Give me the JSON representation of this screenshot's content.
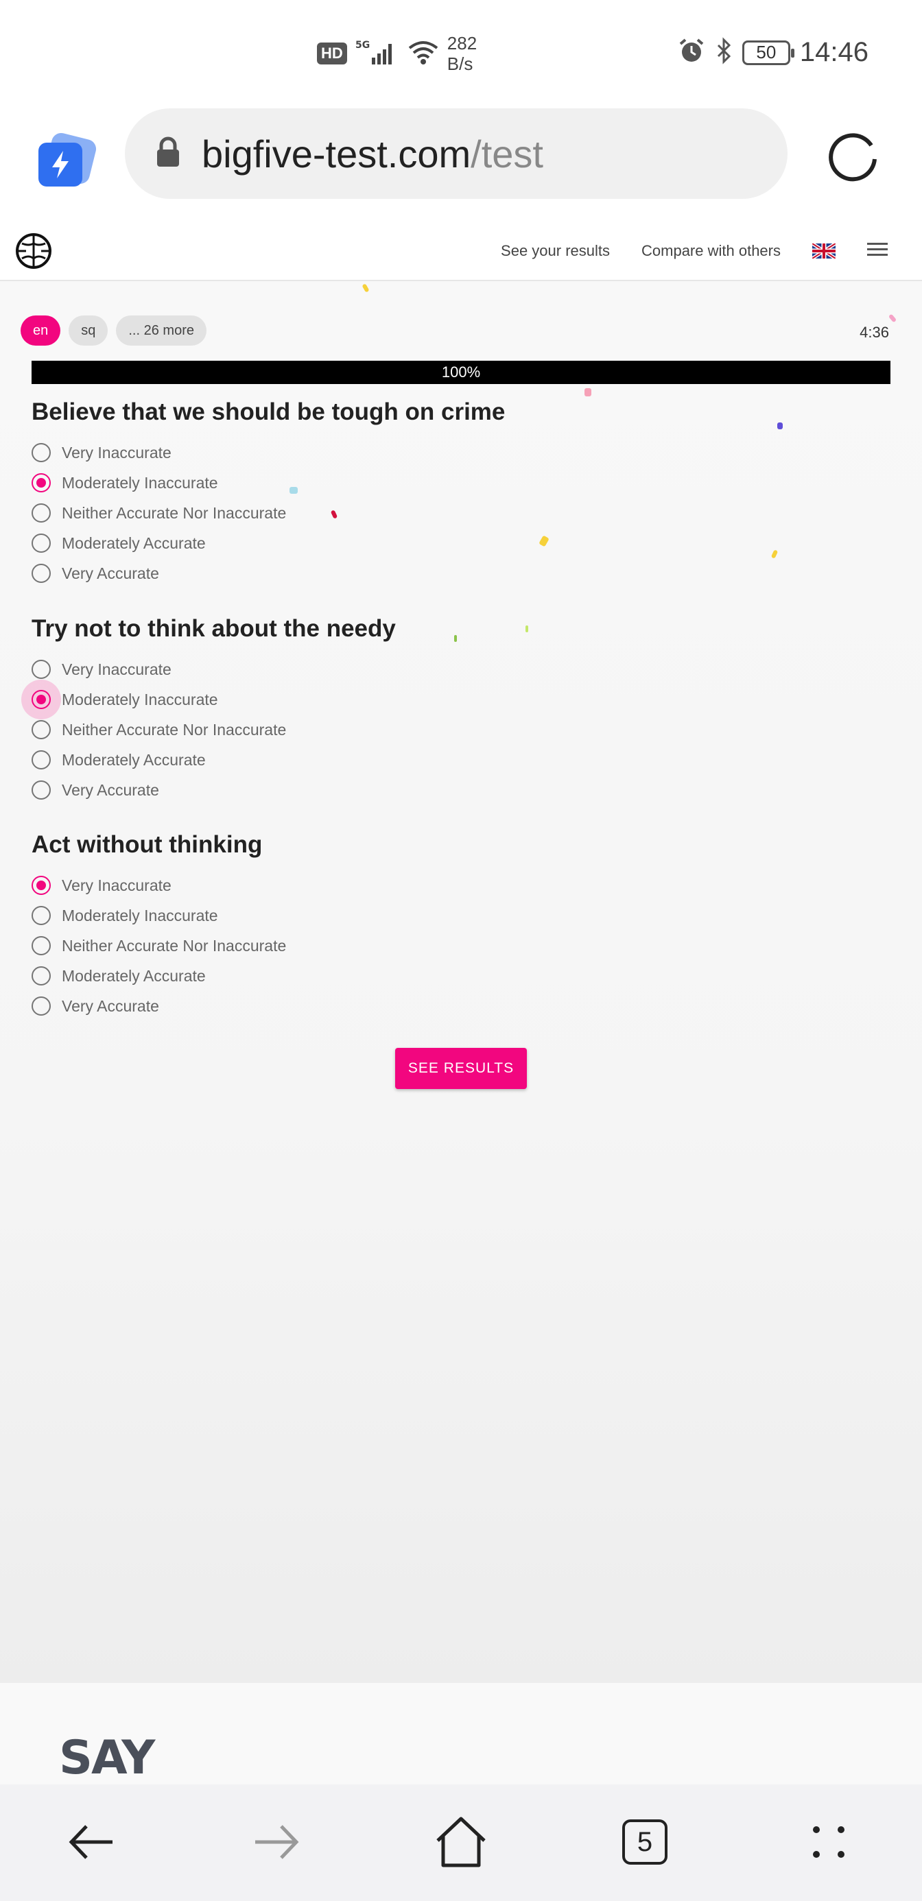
{
  "status_bar": {
    "hd": "HD",
    "network_type": "5G",
    "speed_value": "282",
    "speed_unit": "B/s",
    "battery": "50",
    "time": "14:46"
  },
  "browser": {
    "url_domain": "bigfive-test.com",
    "url_path": "/test",
    "tab_count": "5"
  },
  "site_nav": {
    "see_results_link": "See your results",
    "compare_link": "Compare with others"
  },
  "languages": {
    "items": [
      "en",
      "sq",
      "... 26 more"
    ],
    "active": "en"
  },
  "timer": "4:36",
  "progress": {
    "label": "100%",
    "value": 1.0
  },
  "questions": [
    {
      "title": "Believe that we should be tough on crime",
      "options": [
        "Very Inaccurate",
        "Moderately Inaccurate",
        "Neither Accurate Nor Inaccurate",
        "Moderately Accurate",
        "Very Accurate"
      ],
      "selected_index": 1
    },
    {
      "title": "Try not to think about the needy",
      "options": [
        "Very Inaccurate",
        "Moderately Inaccurate",
        "Neither Accurate Nor Inaccurate",
        "Moderately Accurate",
        "Very Accurate"
      ],
      "selected_index": 1
    },
    {
      "title": "Act without thinking",
      "options": [
        "Very Inaccurate",
        "Moderately Inaccurate",
        "Neither Accurate Nor Inaccurate",
        "Moderately Accurate",
        "Very Accurate"
      ],
      "selected_index": 0
    }
  ],
  "submit_button": "SEE RESULTS",
  "ad_text": "SAY",
  "colors": {
    "accent": "#f2067f",
    "progress_bar": "#000000"
  }
}
